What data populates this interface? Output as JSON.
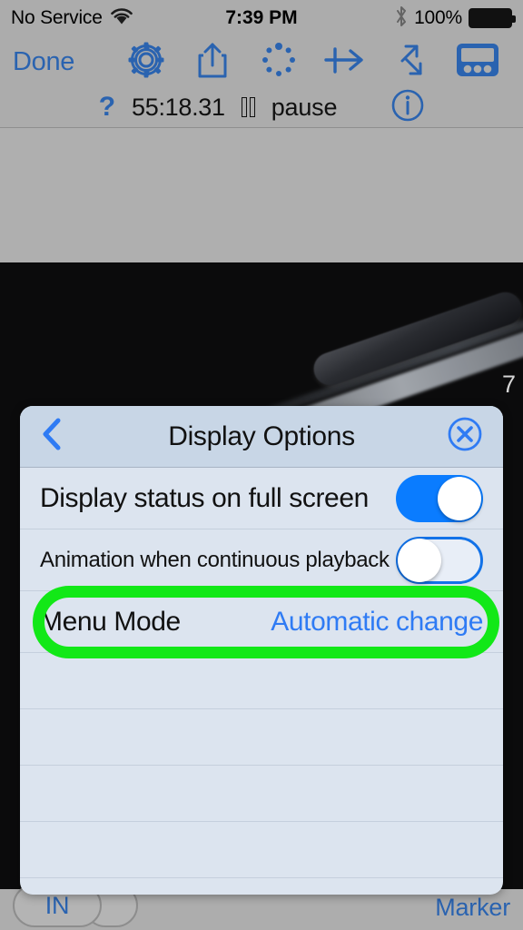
{
  "status_bar": {
    "carrier": "No Service",
    "wifi_icon": "wifi-icon",
    "time": "7:39 PM",
    "bluetooth_icon": "bluetooth-icon",
    "battery_percent": "100%",
    "battery_icon": "battery-full-icon"
  },
  "toolbar": {
    "done_label": "Done",
    "items": [
      {
        "name": "gear-icon",
        "label": "settings"
      },
      {
        "name": "share-icon",
        "label": "share"
      },
      {
        "name": "dotted-circle-icon",
        "label": "progress"
      },
      {
        "name": "plus-arrow-icon",
        "label": "advance"
      },
      {
        "name": "diagonal-resize-icon",
        "label": "resize"
      },
      {
        "name": "panel-icon",
        "label": "panel"
      }
    ]
  },
  "subbar": {
    "help_label": "?",
    "timecode": "55:18.31",
    "pause_icon": "pause-icon",
    "pause_label": "pause",
    "info_icon": "info-icon"
  },
  "video": {
    "background_number": "7"
  },
  "dialog": {
    "title": "Display Options",
    "back_icon": "chevron-left-icon",
    "close_icon": "close-circle-icon",
    "rows": [
      {
        "label": "Display status on full screen",
        "type": "toggle",
        "state": "on"
      },
      {
        "label": "Animation when continuous playback",
        "type": "toggle",
        "state": "off"
      },
      {
        "label": "Menu Mode",
        "type": "value",
        "value": "Automatic change",
        "highlighted": true
      }
    ],
    "empty_row_count": 5
  },
  "bottom_bar": {
    "in_label": "IN",
    "marker_label": "Marker"
  },
  "colors": {
    "accent_blue": "#2f7bf4",
    "toolbar_blue": "#2a63b0",
    "toggle_on": "#0a7cff",
    "highlight_green": "#12e817",
    "chrome_gray": "#acacac",
    "dialog_body": "#dce4ef",
    "dialog_header": "#c8d6e6"
  }
}
